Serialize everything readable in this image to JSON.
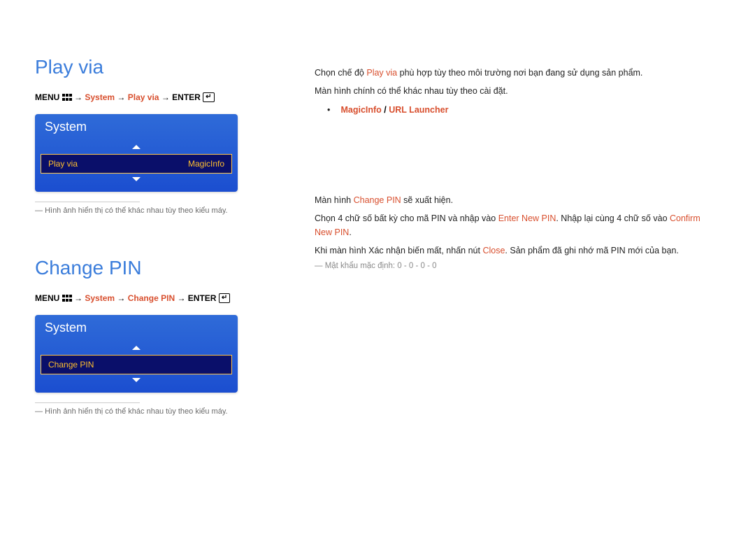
{
  "section1": {
    "heading": "Play via",
    "breadcrumb": {
      "menu": "MENU",
      "arrow": "→",
      "system": "System",
      "item": "Play via",
      "enter": "ENTER"
    },
    "osd": {
      "title": "System",
      "sel_label": "Play via",
      "sel_value": "MagicInfo"
    },
    "footnote_prefix": "― ",
    "footnote": "Hình ảnh hiển thị có thể khác nhau tùy theo kiểu máy.",
    "para1_pre": "Chọn chế độ ",
    "para1_hl": "Play via",
    "para1_post": " phù hợp tùy theo môi trường nơi bạn đang sử dụng sản phẩm.",
    "para2": "Màn hình chính có thể khác nhau tùy theo cài đặt.",
    "bullet_a": "MagicInfo",
    "bullet_sep": " / ",
    "bullet_b": "URL Launcher"
  },
  "section2": {
    "heading": "Change PIN",
    "breadcrumb": {
      "menu": "MENU",
      "arrow": "→",
      "system": "System",
      "item": "Change PIN",
      "enter": "ENTER"
    },
    "osd": {
      "title": "System",
      "sel_label": "Change PIN"
    },
    "footnote_prefix": "― ",
    "footnote": "Hình ảnh hiển thị có thể khác nhau tùy theo kiểu máy.",
    "para1_pre": "Màn hình ",
    "para1_hl": "Change PIN",
    "para1_post": " sẽ xuất hiện.",
    "para2_pre": "Chọn 4 chữ số bất kỳ cho mã PIN và nhập vào ",
    "para2_hl1": "Enter New PIN",
    "para2_mid": ". Nhập lại cùng 4 chữ số vào ",
    "para2_hl2": "Confirm New PIN",
    "para2_post": ".",
    "para3_pre": "Khi màn hình Xác nhận biến mất, nhấn nút ",
    "para3_hl": "Close",
    "para3_post": ". Sản phẩm đã ghi nhớ mã PIN mới của bạn.",
    "dash_note": "― Mật khẩu mặc định: 0 - 0 - 0 - 0"
  }
}
